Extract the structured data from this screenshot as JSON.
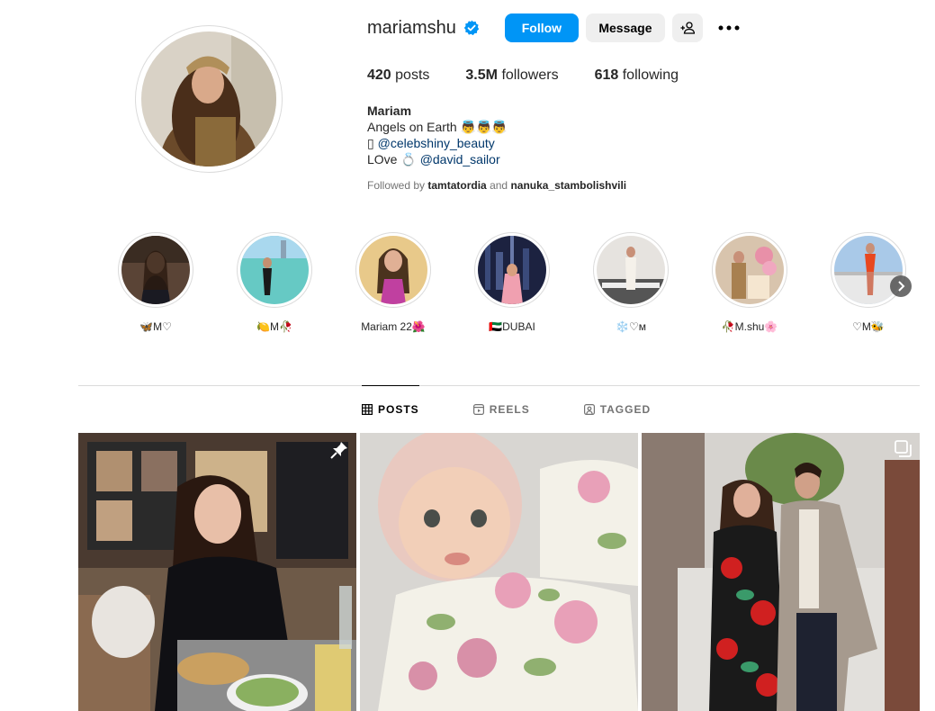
{
  "profile": {
    "username": "mariamshu",
    "follow_label": "Follow",
    "message_label": "Message",
    "stats": {
      "posts": "420",
      "posts_label": "posts",
      "followers": "3.5M",
      "followers_label": "followers",
      "following": "618",
      "following_label": "following"
    },
    "bio": {
      "name": "Mariam",
      "line1": "Angels on Earth 👼👼👼",
      "line2_prefix": "▯",
      "line2_link": "@celebshiny_beauty",
      "line3_prefix": "LOve 💍",
      "line3_link": "@david_sailor"
    },
    "followed_by": {
      "prefix": "Followed by",
      "user1": "tamtatordia",
      "joiner": "and",
      "user2": "nanuka_stambolishvili"
    }
  },
  "highlights": [
    {
      "label": "🦋M♡"
    },
    {
      "label": "🍋M🥀"
    },
    {
      "label": "Mariam 22🌺"
    },
    {
      "label": "🇦🇪DUBAI"
    },
    {
      "label": "❄️♡ᴍ"
    },
    {
      "label": "🥀M.shu🌸"
    },
    {
      "label": "♡M🐝"
    }
  ],
  "tabs": [
    {
      "label": "POSTS",
      "icon": "grid-icon"
    },
    {
      "label": "REELS",
      "icon": "reels-icon"
    },
    {
      "label": "TAGGED",
      "icon": "tagged-icon"
    }
  ],
  "colors": {
    "accent": "#0095f6",
    "link": "#00376b",
    "verified": "#0095f6",
    "secondary_text": "#737373",
    "border": "#dbdbdb"
  }
}
